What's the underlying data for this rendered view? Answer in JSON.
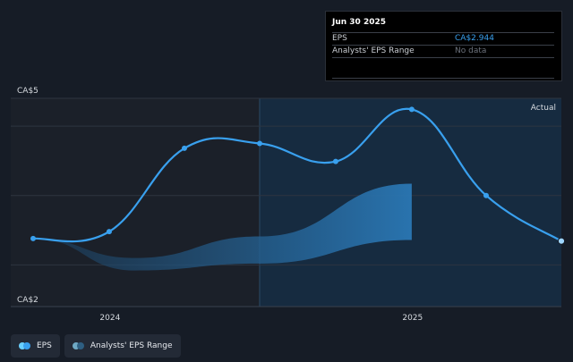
{
  "colors": {
    "background": "#161c26",
    "past_region": "#1b2029",
    "forecast_region": "#162e45",
    "eps_line": "#39a0ee",
    "range_fill": "#2a77b4",
    "gridline": "#2e3540"
  },
  "tooltip": {
    "date": "Jun 30 2025",
    "rows": [
      {
        "label": "EPS",
        "value": "CA$2.944"
      },
      {
        "label": "Analysts' EPS Range",
        "value": "No data"
      }
    ]
  },
  "legend": {
    "items": [
      {
        "label": "EPS"
      },
      {
        "label": "Analysts' EPS Range"
      }
    ]
  },
  "chart_data": {
    "type": "line",
    "title": "",
    "xlabel": "",
    "ylabel": "",
    "y_tick_labels": [
      "CA$5",
      "CA$2"
    ],
    "x_tick_labels": [
      "2024",
      "2025"
    ],
    "region_label": "Actual",
    "ylim": [
      2,
      5
    ],
    "xlim": [
      "2023-09-30",
      "2025-06-30"
    ],
    "grid": true,
    "legend_position": "bottom-left",
    "series": [
      {
        "name": "EPS",
        "points": [
          {
            "x": "2023-09-30",
            "y": 2.98
          },
          {
            "x": "2023-12-31",
            "y": 3.08
          },
          {
            "x": "2024-03-31",
            "y": 4.28
          },
          {
            "x": "2024-06-30",
            "y": 4.35
          },
          {
            "x": "2024-09-30",
            "y": 4.09
          },
          {
            "x": "2024-12-31",
            "y": 4.84
          },
          {
            "x": "2025-03-31",
            "y": 3.6
          },
          {
            "x": "2025-06-30",
            "y": 2.944
          }
        ]
      }
    ],
    "range_band": {
      "name": "Analysts' EPS Range",
      "upper": [
        {
          "x": "2023-09-30",
          "y": 2.98
        },
        {
          "x": "2024-01-31",
          "y": 2.7
        },
        {
          "x": "2024-06-30",
          "y": 3.01
        },
        {
          "x": "2024-12-31",
          "y": 3.77
        }
      ],
      "lower": [
        {
          "x": "2023-09-30",
          "y": 2.98
        },
        {
          "x": "2024-01-31",
          "y": 2.52
        },
        {
          "x": "2024-06-30",
          "y": 2.62
        },
        {
          "x": "2024-12-31",
          "y": 2.96
        }
      ]
    }
  }
}
